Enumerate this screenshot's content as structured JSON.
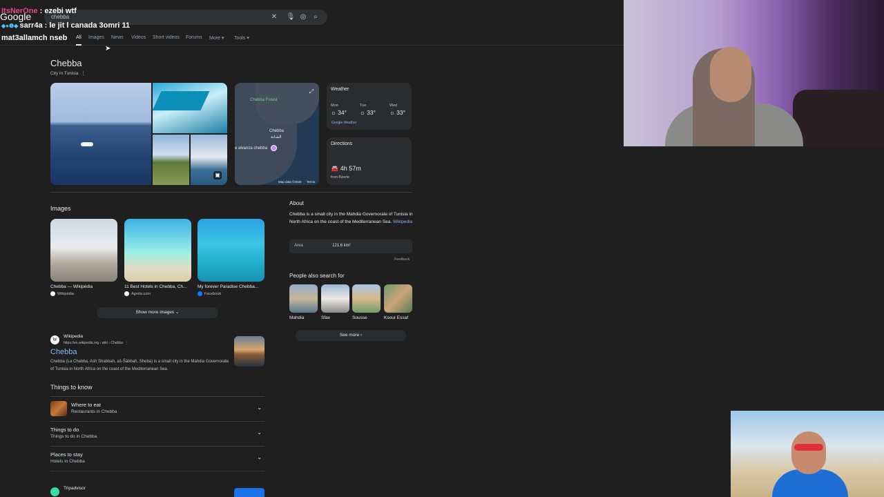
{
  "browser": {
    "logo": "Google",
    "query": "chebba",
    "tabs": [
      "All",
      "Images",
      "News",
      "Videos",
      "Short videos",
      "Forums",
      "More",
      "Tools"
    ]
  },
  "chat": [
    {
      "user": "ItsNerOne",
      "text": " : ezebi wtf",
      "color": "#e3468c"
    },
    {
      "user": "sarr4a",
      "text": " : le jit l canada 3omri 11",
      "color": "#ffffff"
    },
    {
      "user": "mat3allamch nseb",
      "text": "",
      "color": "#ffffff"
    }
  ],
  "knowledge_panel": {
    "title": "Chebba",
    "subtitle": "City in Tunisia",
    "map": {
      "labels": [
        "Chebba Forest",
        "Chebba",
        "الشابة",
        "e alvanza chebba"
      ],
      "attribution": "Map data ©2025",
      "terms": "Terms"
    },
    "weather": {
      "title": "Weather",
      "days": [
        {
          "day": "Mon",
          "temp": "34°"
        },
        {
          "day": "Tue",
          "temp": "33°"
        },
        {
          "day": "Wed",
          "temp": "33°"
        }
      ],
      "source": "Google Weather"
    },
    "directions": {
      "title": "Directions",
      "time": "4h 57m",
      "from": "from Bizerte"
    }
  },
  "images_section": {
    "title": "Images",
    "items": [
      {
        "caption": "Chebba — Wikipédia",
        "source": "Wikipédia",
        "color": "#ffffff"
      },
      {
        "caption": "11 Best Hotels in Chebba, Ch...",
        "source": "Agoda.com",
        "color": "#ffffff"
      },
      {
        "caption": "My forever Paradise Chebba...",
        "source": "Facebook",
        "color": "#1877f2"
      }
    ],
    "show_more": "Show more images"
  },
  "about": {
    "title": "About",
    "text": "Chebba is a small city in the Mahdia Governorate of Tunisia in North Africa on the coast of the Mediterranean Sea.",
    "link": "Wikipedia",
    "area_label": "Area",
    "area_value": "121.6 km²",
    "feedback": "Feedback"
  },
  "people_also_search": {
    "title": "People also search for",
    "items": [
      "Mahdia",
      "Sfax",
      "Sousse",
      "Ksour Essaf"
    ],
    "see_more": "See more"
  },
  "wiki_result": {
    "site": "Wikipedia",
    "url": "https://en.wikipedia.org › wiki › Chebba",
    "title": "Chebba",
    "snippet": "Chebba (La Chebba, Ash Shabbah, aš-Šābbah, Sheba) is a small city in the Mahdia Governorate of Tunisia in North Africa on the coast of the Mediterranean Sea."
  },
  "things_to_know": {
    "title": "Things to know",
    "items": [
      {
        "title": "Where to eat",
        "sub": "Restaurants in Chebba"
      },
      {
        "title": "Things to do",
        "sub": "Things to do in Chebba"
      },
      {
        "title": "Places to stay",
        "sub": "Hotels in Chebba"
      }
    ]
  },
  "tripadvisor": {
    "site": "Tripadvisor"
  }
}
